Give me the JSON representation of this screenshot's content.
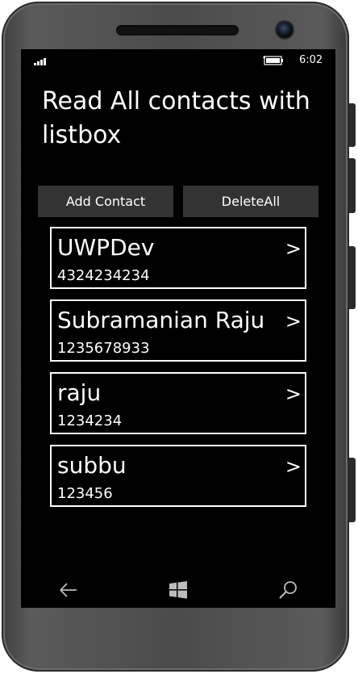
{
  "statusbar": {
    "time": "6:02",
    "signal_icon": "signal-icon",
    "battery_icon": "battery-icon"
  },
  "page": {
    "title": "Read All contacts with listbox"
  },
  "toolbar": {
    "add_label": "Add Contact",
    "delete_label": "DeleteAll"
  },
  "contacts": [
    {
      "name": "UWPDev",
      "phone": "4324234234",
      "chevron": ">"
    },
    {
      "name": "Subramanian Raju",
      "phone": "1235678933",
      "chevron": ">"
    },
    {
      "name": "raju",
      "phone": "1234234",
      "chevron": ">"
    },
    {
      "name": "subbu",
      "phone": "123456",
      "chevron": ">"
    }
  ],
  "navbar": {
    "back_icon": "back-arrow-icon",
    "start_icon": "windows-logo-icon",
    "search_icon": "search-icon"
  },
  "colors": {
    "screen_bg": "#000000",
    "button_bg": "#333333",
    "text": "#ffffff",
    "nav_icon": "#bdbdbd"
  }
}
